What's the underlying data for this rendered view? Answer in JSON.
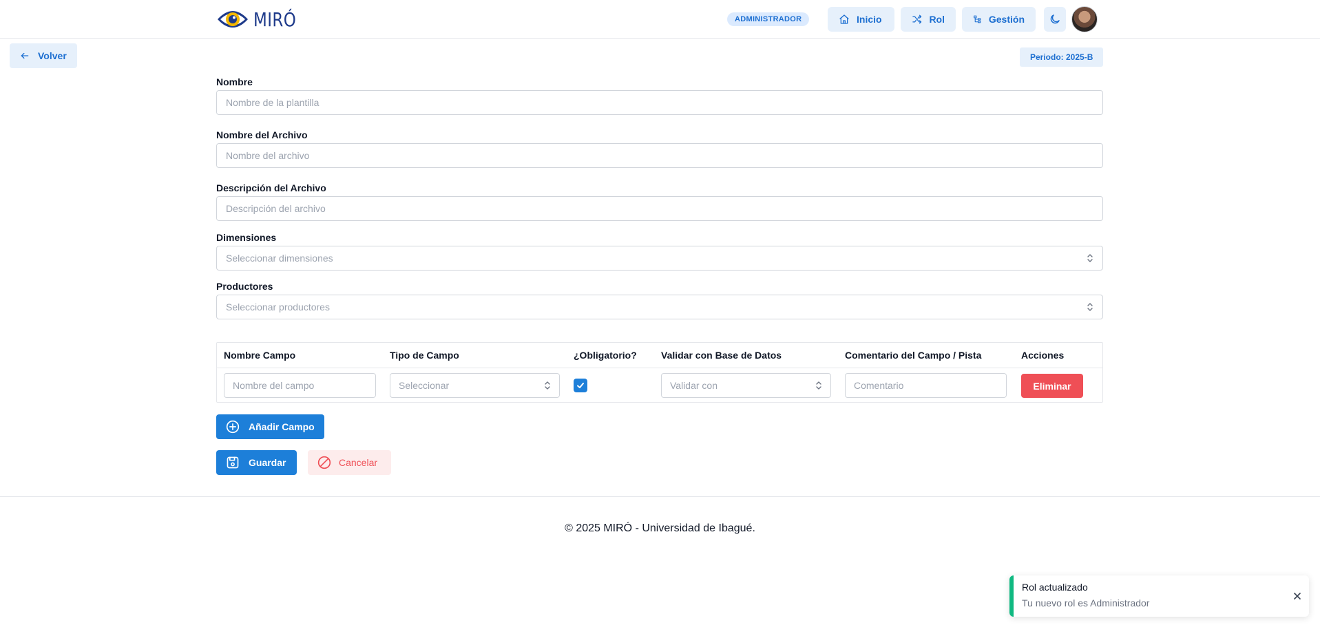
{
  "header": {
    "logo_text": "MIRÓ",
    "role_badge": "ADMINISTRADOR",
    "nav": {
      "inicio": "Inicio",
      "rol": "Rol",
      "gestion": "Gestión"
    },
    "icons": [
      "home-icon",
      "shuffle-icon",
      "hierarchy-icon",
      "moon-icon"
    ]
  },
  "back_label": "Volver",
  "periodo": "Periodo: 2025-B",
  "form": {
    "nombre": {
      "label": "Nombre",
      "placeholder": "Nombre de la plantilla",
      "value": ""
    },
    "archivo": {
      "label": "Nombre del Archivo",
      "placeholder": "Nombre del archivo",
      "value": ""
    },
    "descripcion": {
      "label": "Descripción del Archivo",
      "placeholder": "Descripción del archivo",
      "value": ""
    },
    "dimensiones": {
      "label": "Dimensiones",
      "placeholder": "Seleccionar dimensiones"
    },
    "productores": {
      "label": "Productores",
      "placeholder": "Seleccionar productores"
    }
  },
  "table": {
    "headers": [
      "Nombre Campo",
      "Tipo de Campo",
      "¿Obligatorio?",
      "Validar con Base de Datos",
      "Comentario del Campo / Pista",
      "Acciones"
    ],
    "row": {
      "nombre_placeholder": "Nombre del campo",
      "tipo_placeholder": "Seleccionar",
      "obligatorio": true,
      "validar_placeholder": "Validar con",
      "comentario_placeholder": "Comentario",
      "eliminar_label": "Eliminar"
    }
  },
  "buttons": {
    "add_field": "Añadir Campo",
    "save": "Guardar",
    "cancel": "Cancelar"
  },
  "footer_text": "© 2025 MIRÓ - Universidad de Ibagué.",
  "toast": {
    "title": "Rol actualizado",
    "message": "Tu nuevo rol es Administrador",
    "accent": "#10b981"
  },
  "colors": {
    "primary": "#1d7fd9",
    "danger": "#ef4f56",
    "soft_blue": "#e6f0fb"
  }
}
